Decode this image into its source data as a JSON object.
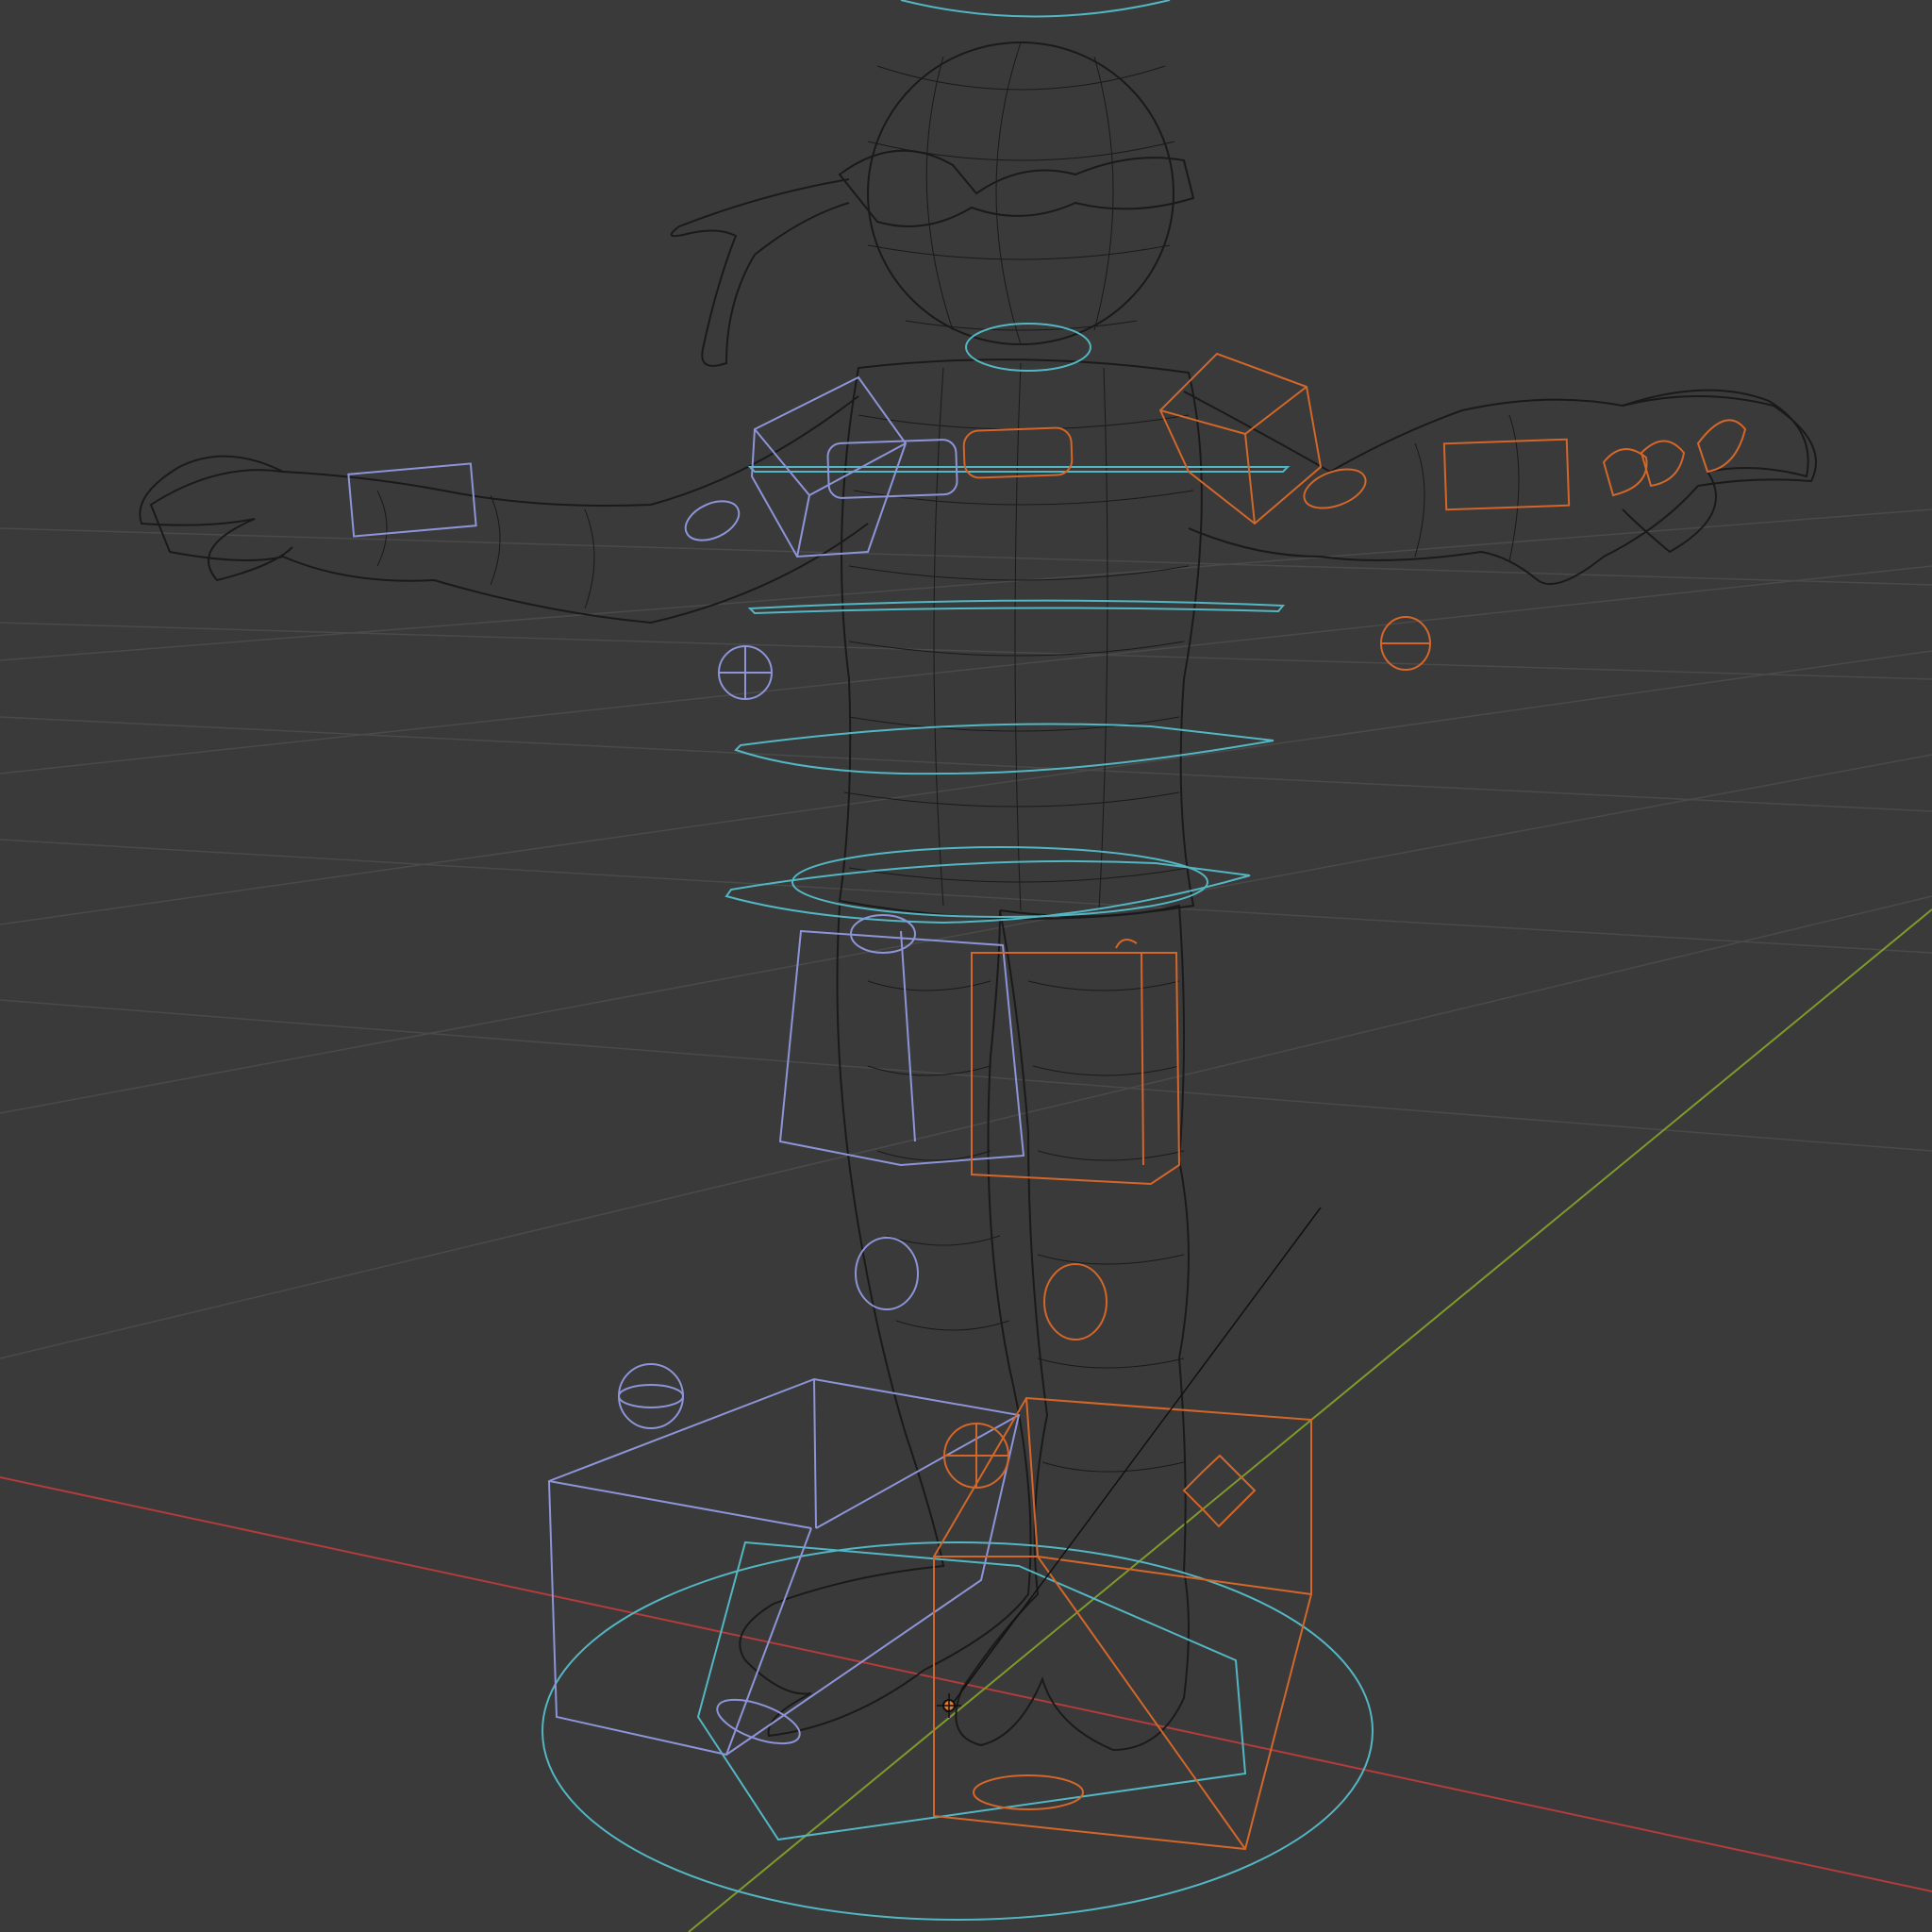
{
  "viewport": {
    "background": "#3a3a3a",
    "mode": "wireframe",
    "object": "rigged-character"
  },
  "colors": {
    "grid": "#4a4a4a",
    "axis_x": "#b23c3c",
    "axis_y": "#7f9a2c",
    "mesh": "#1a1a1a",
    "control_center": "#53b7c3",
    "control_left": "#8d94d8",
    "control_right": "#d3672a"
  },
  "icons": {
    "origin": "object-origin-icon"
  }
}
